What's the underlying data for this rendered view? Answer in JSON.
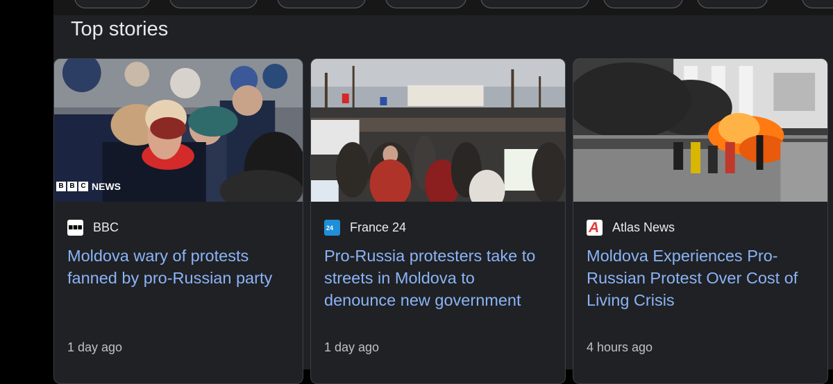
{
  "section": {
    "title": "Top stories"
  },
  "stories": [
    {
      "source": "BBC",
      "headline": "Moldova wary of protests fanned by pro-Russian party",
      "time": "1 day ago",
      "image_watermark": {
        "letters": [
          "B",
          "B",
          "C"
        ],
        "word": "NEWS"
      },
      "icon": "bbc-logo-icon"
    },
    {
      "source": "France 24",
      "headline": "Pro-Russia protesters take to streets in Moldova to denounce new government",
      "time": "1 day ago",
      "icon": "france24-logo-icon",
      "icon_text": "24"
    },
    {
      "source": "Atlas News",
      "headline": "Moldova Experiences Pro-Russian Protest Over Cost of Living Crisis",
      "time": "4 hours ago",
      "icon": "atlas-news-logo-icon",
      "icon_text": "A"
    }
  ],
  "colors": {
    "background": "#202124",
    "card_border": "#3c4043",
    "headline": "#8ab4f8",
    "title": "#e8eaed",
    "meta": "#bdc1c6",
    "france24_blue": "#1e8fd8",
    "atlas_red": "#e53935"
  }
}
